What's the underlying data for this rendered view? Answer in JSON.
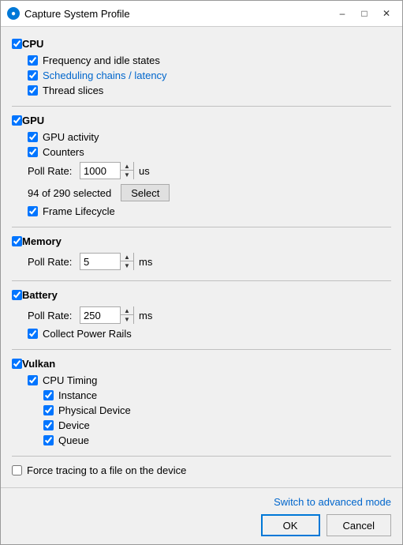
{
  "window": {
    "title": "Capture System Profile",
    "icon": "●"
  },
  "sections": {
    "cpu": {
      "label": "CPU",
      "checked": true,
      "children": [
        {
          "label": "Frequency and idle states",
          "checked": true,
          "blue": false
        },
        {
          "label": "Scheduling chains / latency",
          "checked": true,
          "blue": true
        },
        {
          "label": "Thread slices",
          "checked": true,
          "blue": false
        }
      ]
    },
    "gpu": {
      "label": "GPU",
      "checked": true,
      "gpu_activity": {
        "label": "GPU activity",
        "checked": true
      },
      "counters": {
        "label": "Counters",
        "checked": true
      },
      "poll_rate": {
        "label": "Poll Rate:",
        "value": "1000",
        "unit": "us"
      },
      "selection_info": "94 of 290 selected",
      "select_btn": "Select",
      "frame_lifecycle": {
        "label": "Frame Lifecycle",
        "checked": true
      }
    },
    "memory": {
      "label": "Memory",
      "checked": true,
      "poll_rate": {
        "label": "Poll Rate:",
        "value": "5",
        "unit": "ms"
      }
    },
    "battery": {
      "label": "Battery",
      "checked": true,
      "poll_rate": {
        "label": "Poll Rate:",
        "value": "250",
        "unit": "ms"
      },
      "collect_power_rails": {
        "label": "Collect Power Rails",
        "checked": true
      }
    },
    "vulkan": {
      "label": "Vulkan",
      "checked": true,
      "cpu_timing": {
        "label": "CPU Timing",
        "checked": true,
        "children": [
          {
            "label": "Instance",
            "checked": true
          },
          {
            "label": "Physical Device",
            "checked": true
          },
          {
            "label": "Device",
            "checked": true
          },
          {
            "label": "Queue",
            "checked": true
          }
        ]
      }
    }
  },
  "force_tracing": {
    "label": "Force tracing to a file on the device",
    "checked": false
  },
  "footer": {
    "advanced_link": "Switch to advanced mode",
    "ok_label": "OK",
    "cancel_label": "Cancel"
  }
}
